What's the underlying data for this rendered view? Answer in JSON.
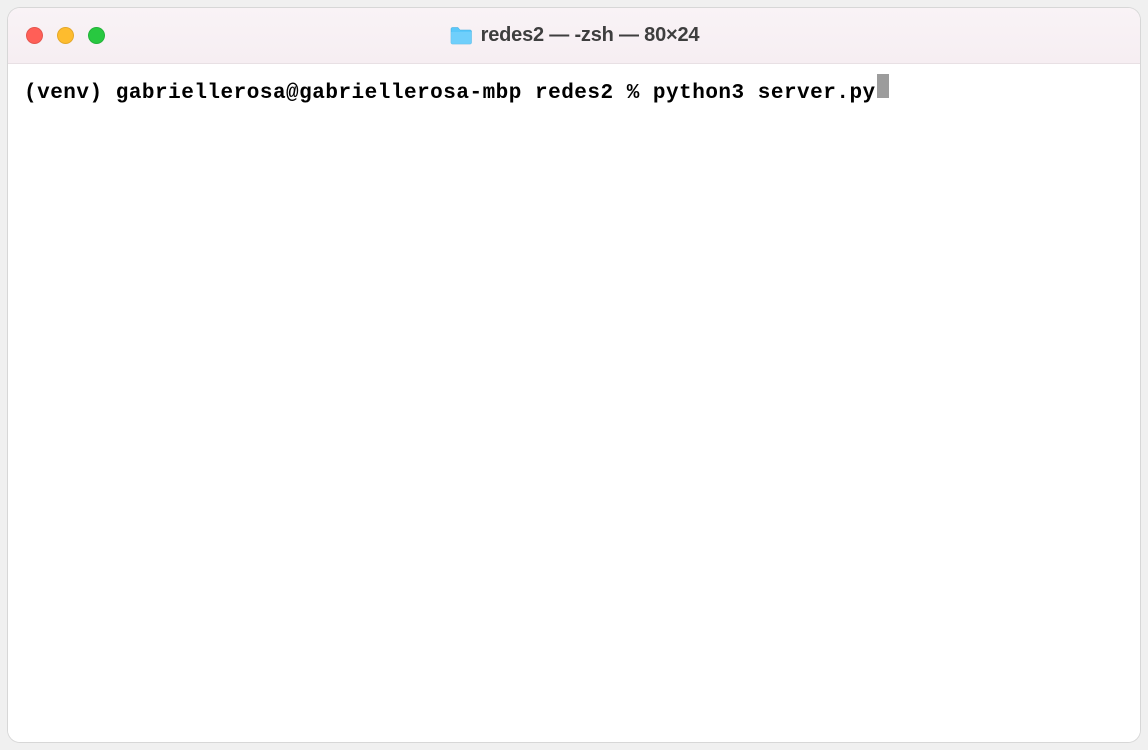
{
  "window": {
    "title": "redes2 — -zsh — 80×24"
  },
  "terminal": {
    "line1": {
      "venv": "(venv) ",
      "user_host": "gabriellerosa@gabriellerosa-mbp ",
      "directory": "redes2 ",
      "prompt_symbol": "% ",
      "command": "python3 server.py"
    }
  }
}
